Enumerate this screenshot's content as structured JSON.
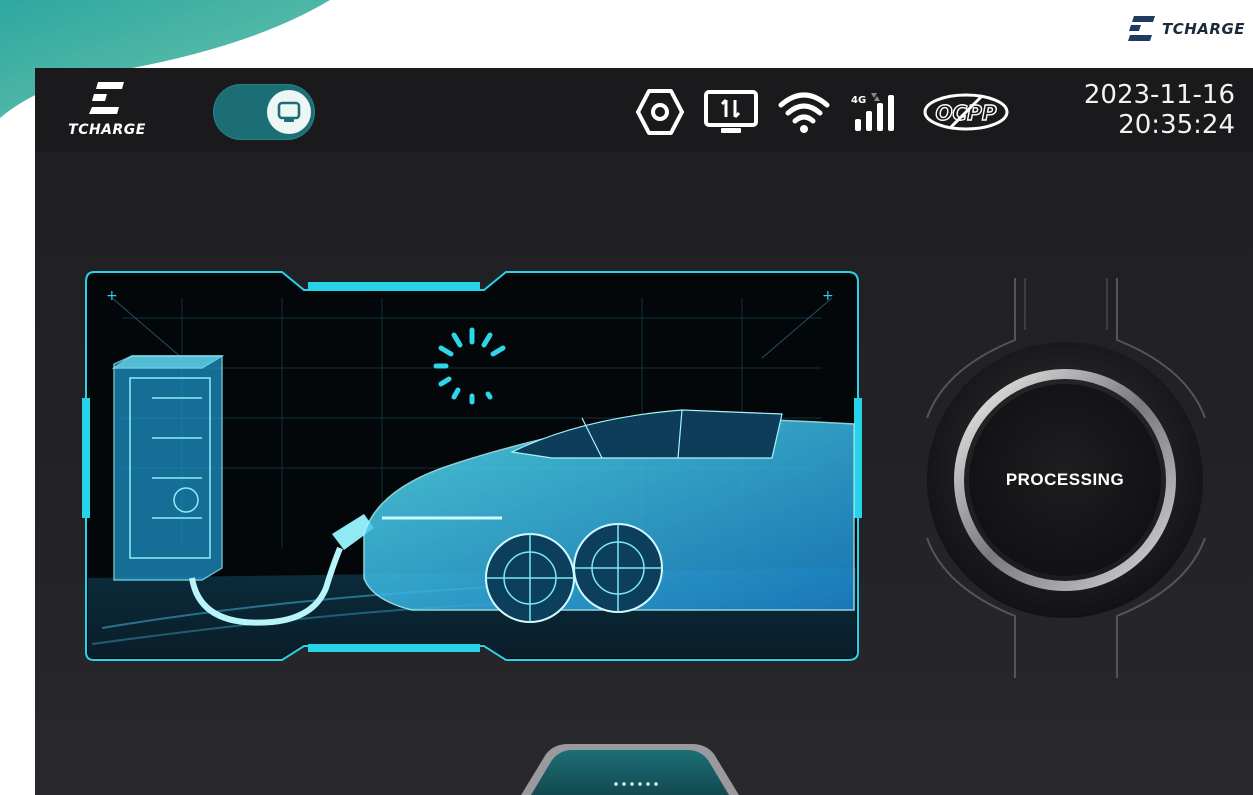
{
  "brand": {
    "name": "TCHARGE"
  },
  "header": {
    "logo_text": "TCHARGE",
    "mode_toggle_icon": "screen-icon",
    "status_icons": [
      "settings-hex-icon",
      "data-transfer-icon",
      "wifi-icon",
      "cellular-4g-icon",
      "ocpp-disconnected-icon"
    ],
    "cellular_label": "4G",
    "ocpp_label": "OCPP",
    "date": "2023-11-16",
    "time": "20:35:24"
  },
  "main": {
    "illustration": "ev-charging-car-illustration",
    "loading_icon": "spinner-icon",
    "action_button_label": "PROCESSING",
    "bottom_tab_icon": "dots-icon"
  },
  "colors": {
    "accent": "#27d3e6",
    "toggle": "#1b6e73",
    "header_bg": "#1a1a1d",
    "screen_bg": "#232327"
  }
}
